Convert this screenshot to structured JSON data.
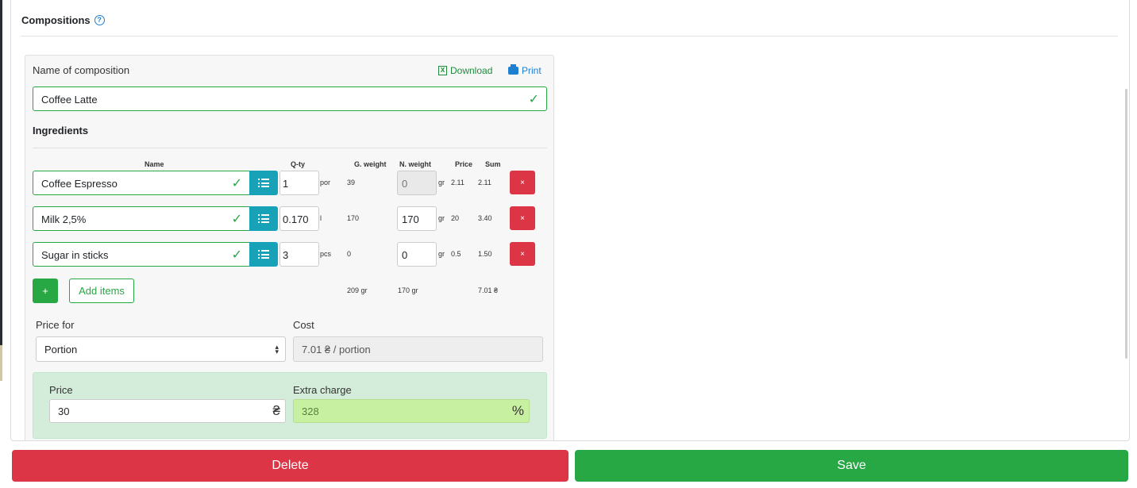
{
  "section": {
    "title": "Compositions",
    "help_icon": "question-circle-icon"
  },
  "composition": {
    "name_label": "Name of composition",
    "download_label": "Download",
    "print_label": "Print",
    "name_value": "Coffee Latte"
  },
  "ingredients": {
    "title": "Ingredients",
    "headers": {
      "name": "Name",
      "qty": "Q-ty",
      "gross": "G. weight",
      "net": "N. weight",
      "price": "Price",
      "sum": "Sum"
    },
    "rows": [
      {
        "name": "Coffee Espresso",
        "qty": "1",
        "unit": "por",
        "gross": "39",
        "net": "0",
        "net_unit": "gr",
        "price": "2.11",
        "sum": "2.11",
        "net_disabled": true
      },
      {
        "name": "Milk 2,5%",
        "qty": "0.170",
        "unit": "l",
        "gross": "170",
        "net": "170",
        "net_unit": "gr",
        "price": "20",
        "sum": "3.40",
        "net_disabled": false
      },
      {
        "name": "Sugar in sticks",
        "qty": "3",
        "unit": "pcs",
        "gross": "0",
        "net": "0",
        "net_unit": "gr",
        "price": "0.5",
        "sum": "1.50",
        "net_disabled": false
      }
    ],
    "add_label": "+",
    "add_items_label": "Add items",
    "remove_label": "×",
    "totals": {
      "gross": "209 gr",
      "net": "170 gr",
      "sum": "7.01 ₴"
    }
  },
  "pricing": {
    "price_for_label": "Price for",
    "price_for_value": "Portion",
    "cost_label": "Cost",
    "cost_value": "7.01 ₴ / portion",
    "price_label": "Price",
    "price_value": "30",
    "currency_symbol": "₴",
    "extra_label": "Extra charge",
    "extra_value": "328",
    "percent_symbol": "%"
  },
  "actions": {
    "delete_label": "Delete",
    "save_label": "Save"
  },
  "colors": {
    "success": "#28a745",
    "danger": "#dc3545",
    "info": "#17a2b8",
    "link": "#1e7fd1"
  }
}
